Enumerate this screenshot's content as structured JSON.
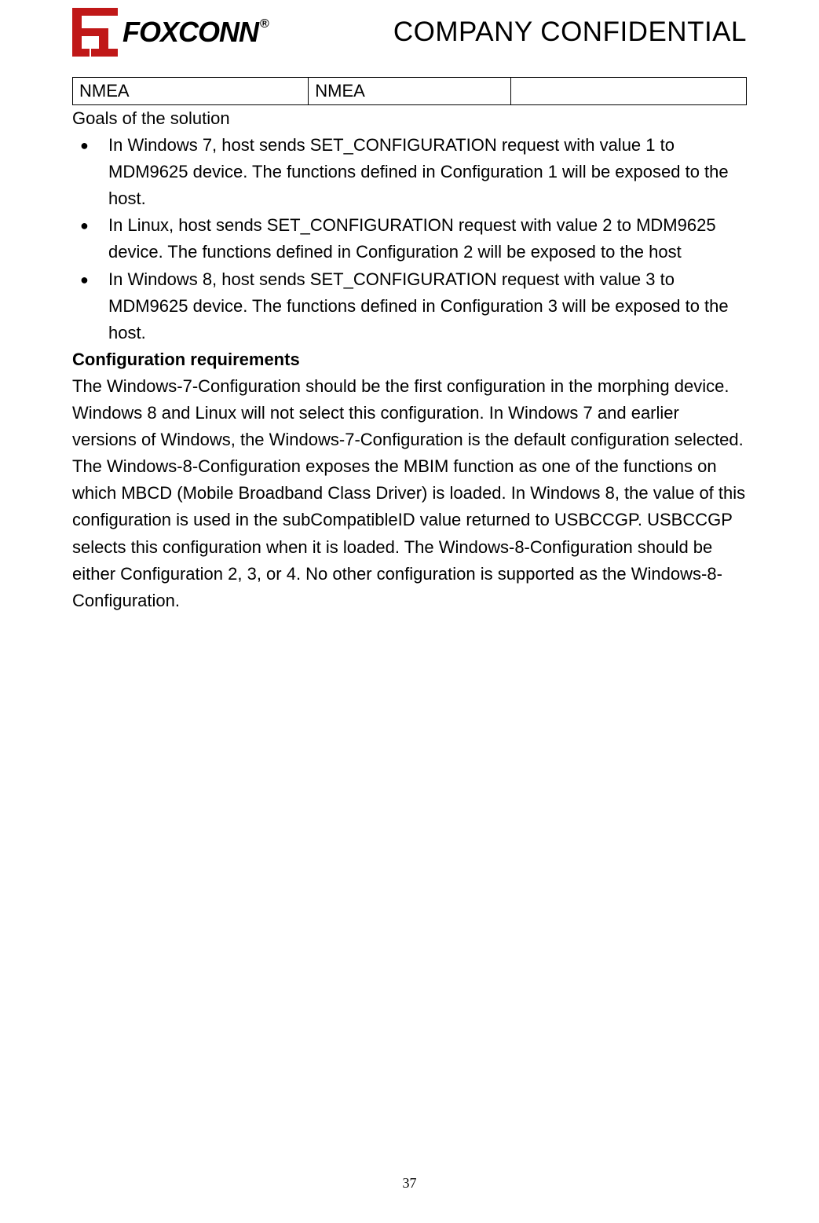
{
  "header": {
    "brand_name": "FOXCONN",
    "registered_mark": "®",
    "title": "COMPANY CONFIDENTIAL"
  },
  "table": {
    "row": {
      "col1": "NMEA",
      "col2": "NMEA",
      "col3": ""
    }
  },
  "goals": {
    "heading": "Goals of the solution",
    "items": [
      "In Windows 7, host sends SET_CONFIGURATION request with value 1 to MDM9625 device. The functions defined in Configuration 1 will be exposed to the host.",
      "In Linux, host sends SET_CONFIGURATION request with value 2 to MDM9625 device. The functions defined in Configuration 2 will be exposed to the host",
      "In Windows 8, host sends SET_CONFIGURATION request with value 3 to MDM9625 device. The functions defined in Configuration 3 will be exposed to the host."
    ]
  },
  "config": {
    "heading": "Configuration requirements",
    "para1": "The Windows-7-Configuration should be the first configuration in the morphing device. Windows 8 and Linux will not select this configuration. In Windows 7 and earlier versions of Windows, the Windows-7-Configuration is the default configuration selected.",
    "para2": "The Windows-8-Configuration exposes the MBIM function as one of the functions on which MBCD (Mobile Broadband Class Driver) is loaded. In Windows 8, the value of this configuration is used in the subCompatibleID value returned to USBCCGP. USBCCGP selects this configuration when it is loaded. The Windows-8-Configuration should be either Configuration 2, 3, or 4. No other configuration is supported as the Windows-8-Configuration."
  },
  "page_number": "37"
}
